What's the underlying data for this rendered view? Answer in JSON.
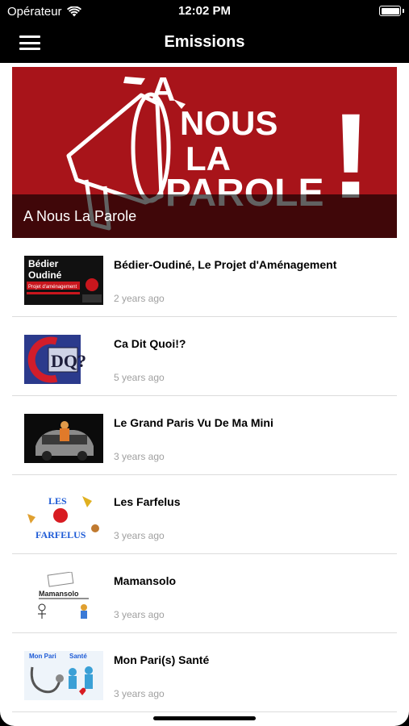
{
  "status_bar": {
    "carrier": "Opérateur",
    "time": "12:02 PM"
  },
  "nav": {
    "title": "Emissions",
    "menu_icon": "hamburger-menu-icon"
  },
  "hero": {
    "caption": "A Nous La Parole",
    "art_text": [
      "A",
      "NOUS",
      "LA",
      "PAROLE",
      "!"
    ],
    "color": "#a8141a"
  },
  "items": [
    {
      "title": "Bédier-Oudiné, Le Projet d'Aménagement",
      "time": "2 years ago",
      "thumb_text": [
        "Bédier",
        "Oudiné",
        "Projet d'aménagement"
      ]
    },
    {
      "title": "Ca Dit Quoi!?",
      "time": "5 years ago",
      "thumb_text": [
        "DQ?"
      ]
    },
    {
      "title": "Le Grand Paris Vu De Ma Mini",
      "time": "3 years ago",
      "thumb_text": []
    },
    {
      "title": "Les Farfelus",
      "time": "3 years ago",
      "thumb_text": [
        "LES",
        "FARFELUS"
      ]
    },
    {
      "title": "Mamansolo",
      "time": "3 years ago",
      "thumb_text": [
        "Mamansolo"
      ]
    },
    {
      "title": "Mon Pari(s) Santé",
      "time": "3 years ago",
      "thumb_text": [
        "Mon Pari",
        "Santé"
      ]
    }
  ]
}
